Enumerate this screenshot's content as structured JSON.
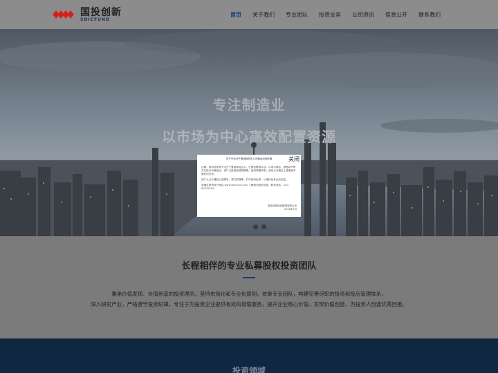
{
  "header": {
    "logo_cn": "国投创新",
    "logo_en": "SDICFUND",
    "nav": [
      {
        "label": "首页",
        "active": true
      },
      {
        "label": "关于我们",
        "active": false
      },
      {
        "label": "专业团队",
        "active": false
      },
      {
        "label": "投资业务",
        "active": false
      },
      {
        "label": "公司资讯",
        "active": false
      },
      {
        "label": "信息公开",
        "active": false
      },
      {
        "label": "联系我们",
        "active": false
      }
    ]
  },
  "hero": {
    "title1": "专注制造业",
    "title2": "以市场为中心高效配置资源"
  },
  "popup": {
    "title": "关于不法分子冒用我司名义诈骗活动的声明",
    "close_label": "关闭",
    "para1": "近期，我司发现有不法分子冒用我司名义，在微信群等平台，以非法网站、虚假APP等方式进行诈骗活动，请广大投资者提高警惕。我司郑重声明，我司从未通过上述渠道开展任何业务。",
    "para2": "如广大公众遇到上述情况，请立即报警，并向我司反馈，以维护自身合法权益。",
    "para3": "请通过我司官方网站 www.sdicfund.com 了解我司相关信息，联系电话：010-83325000。",
    "sign1": "国投创新投资管理有限公司",
    "sign2": "2024年7月",
    "accent": "#ffffff"
  },
  "intro": {
    "title": "长程相伴的专业私募股权投资团队",
    "line1": "秉承价值发现、价值创造的投资理念，坚持市场化和专业化原则，依靠专业团队，构建完善尽职的投资和投后管理体系，",
    "line2": "深入研究产业，严格遵守投资纪律，专注于为投资企业提供有效的增值服务，提升企业核心价值，实现价值创造，为投资人创造优秀回报。"
  },
  "invest": {
    "title": "投资领域"
  },
  "colors": {
    "brand_red": "#d7231e",
    "brand_navy": "#0f3d7a",
    "footer_band": "#0f2740"
  }
}
